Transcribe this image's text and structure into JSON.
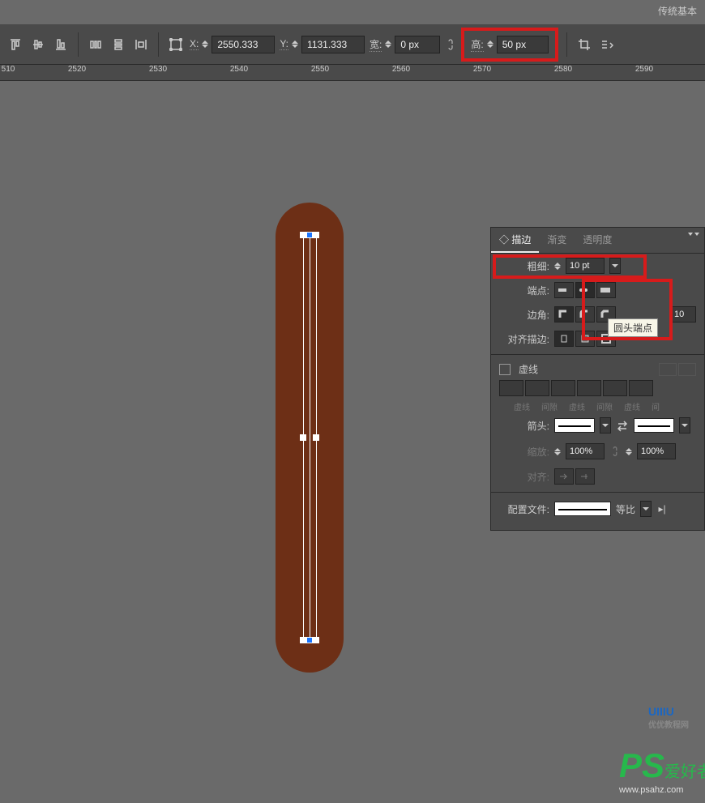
{
  "topbar": {
    "workspace": "传统基本"
  },
  "options": {
    "x_label": "X:",
    "x_value": "2550.333",
    "y_label": "Y:",
    "y_value": "1131.333",
    "w_label": "宽:",
    "w_value": "0 px",
    "h_label": "高:",
    "h_value": "50 px"
  },
  "ruler": {
    "ticks": [
      "510",
      "2520",
      "2530",
      "2540",
      "2550",
      "2560",
      "2570",
      "2580",
      "2590"
    ]
  },
  "panel": {
    "tabs": {
      "stroke": "描边",
      "gradient": "渐变",
      "opacity": "透明度"
    },
    "weight_label": "粗细:",
    "weight_value": "10 pt",
    "cap_label": "端点:",
    "corner_label": "边角:",
    "corner_tooltip": "圆头端点",
    "limit_value": "10",
    "align_label": "对齐描边:",
    "dashed_label": "虚线",
    "dash_cols": [
      "虚线",
      "间隙",
      "虚线",
      "间隙",
      "虚线",
      "间"
    ],
    "arrow_label": "箭头:",
    "scale_label": "缩放:",
    "scale_value": "100%",
    "align_arrow_label": "对齐:",
    "profile_label": "配置文件:",
    "profile_value": "等比"
  },
  "watermarks": {
    "uisdc_sub": "优优教程网",
    "ps_text": "爱好者",
    "ps_url": "www.psahz.com"
  }
}
